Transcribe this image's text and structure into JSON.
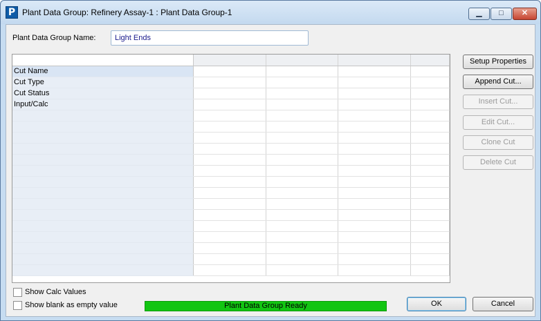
{
  "window": {
    "title": "Plant Data Group: Refinery Assay-1 : Plant Data Group-1",
    "app_icon_letter": "P",
    "min_glyph": "▁",
    "max_glyph": "□",
    "close_glyph": "✕"
  },
  "name_field": {
    "label": "Plant Data Group Name:",
    "value": "Light Ends"
  },
  "grid": {
    "columns": [
      "",
      "",
      "",
      "",
      ""
    ],
    "row_headers": [
      "Cut Name",
      "Cut Type",
      "Cut Status",
      "Input/Calc"
    ]
  },
  "side_buttons": {
    "setup_properties": "Setup Properties",
    "append_cut": "Append Cut...",
    "insert_cut": "Insert Cut...",
    "edit_cut": "Edit Cut...",
    "clone_cut": "Clone Cut",
    "delete_cut": "Delete Cut"
  },
  "options": {
    "show_calc_values": {
      "label": "Show Calc Values",
      "checked": false
    },
    "show_blank": {
      "label": "Show blank as empty value",
      "checked": false
    }
  },
  "status": {
    "text": "Plant Data Group Ready",
    "color": "#12c512"
  },
  "footer": {
    "ok": "OK",
    "cancel": "Cancel"
  }
}
